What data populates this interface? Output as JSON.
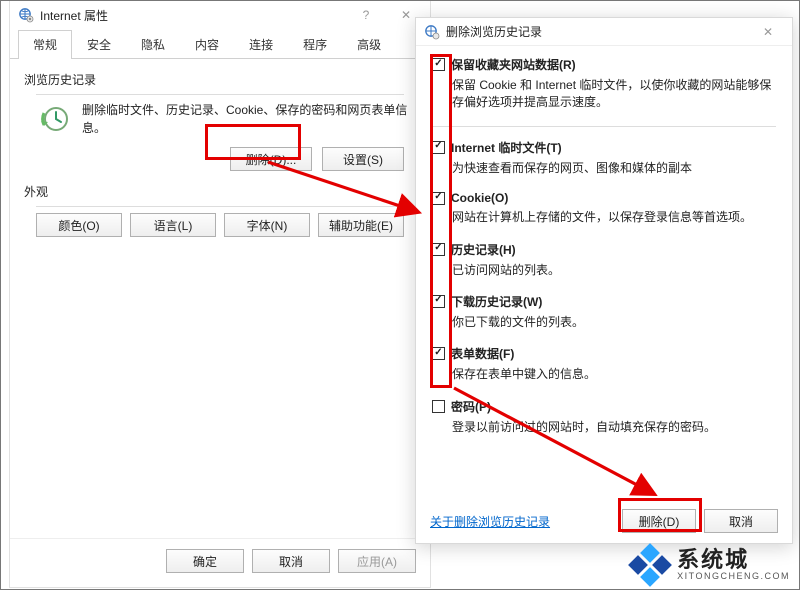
{
  "left": {
    "title": "Internet 属性",
    "sys": {
      "help": "?",
      "close": "✕"
    },
    "tabs": [
      "常规",
      "安全",
      "隐私",
      "内容",
      "连接",
      "程序",
      "高级"
    ],
    "history": {
      "group": "浏览历史记录",
      "desc": "删除临时文件、历史记录、Cookie、保存的密码和网页表单信息。",
      "delete": "删除(D)...",
      "settings": "设置(S)"
    },
    "appearance": {
      "group": "外观",
      "color": "颜色(O)",
      "language": "语言(L)",
      "font": "字体(N)",
      "accessibility": "辅助功能(E)"
    },
    "footer": {
      "ok": "确定",
      "cancel": "取消",
      "apply": "应用(A)"
    }
  },
  "right": {
    "title": "删除浏览历史记录",
    "close": "✕",
    "items": [
      {
        "checked": true,
        "label": "保留收藏夹网站数据(R)",
        "desc": "保留 Cookie 和 Internet 临时文件，以使你收藏的网站能够保存偏好选项并提高显示速度。",
        "sep": true
      },
      {
        "checked": true,
        "label": "Internet 临时文件(T)",
        "desc": "为快速查看而保存的网页、图像和媒体的副本"
      },
      {
        "checked": true,
        "label": "Cookie(O)",
        "desc": "网站在计算机上存储的文件，以保存登录信息等首选项。"
      },
      {
        "checked": true,
        "label": "历史记录(H)",
        "desc": "已访问网站的列表。"
      },
      {
        "checked": true,
        "label": "下载历史记录(W)",
        "desc": "你已下载的文件的列表。"
      },
      {
        "checked": true,
        "label": "表单数据(F)",
        "desc": "保存在表单中键入的信息。"
      },
      {
        "checked": false,
        "label": "密码(P)",
        "desc": "登录以前访问过的网站时，自动填充保存的密码。"
      }
    ],
    "link": "关于删除浏览历史记录",
    "delete": "删除(D)",
    "cancel": "取消"
  },
  "watermark": {
    "cn": "系统城",
    "en": "XITONGCHENG.COM"
  },
  "colors": {
    "red": "#e30000",
    "wm1": "#2aa6ff",
    "wm2": "#1a4aa3"
  }
}
